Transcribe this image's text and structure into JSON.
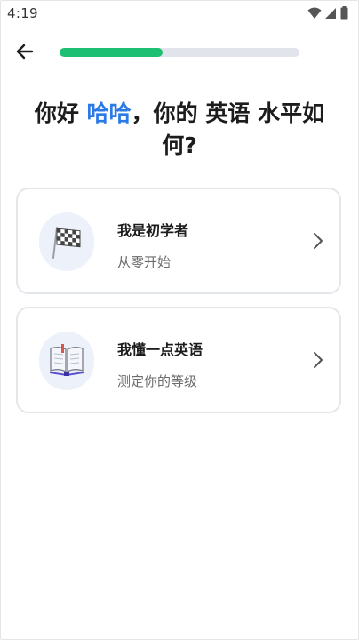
{
  "status_bar": {
    "time": "4:19",
    "icons": [
      "wifi-icon",
      "signal-icon",
      "battery-icon"
    ]
  },
  "header": {
    "back_icon": "arrow-left-icon",
    "progress_percent": 43,
    "progress_color": "#1dbf73"
  },
  "title": {
    "prefix": "你好 ",
    "name": "哈哈",
    "suffix": "，你的 英语 水平如何?",
    "highlight_color": "#2a79e6"
  },
  "options": [
    {
      "icon": "checkered-flag-icon",
      "title": "我是初学者",
      "subtitle": "从零开始"
    },
    {
      "icon": "open-book-icon",
      "title": "我懂一点英语",
      "subtitle": "测定你的等级"
    }
  ]
}
